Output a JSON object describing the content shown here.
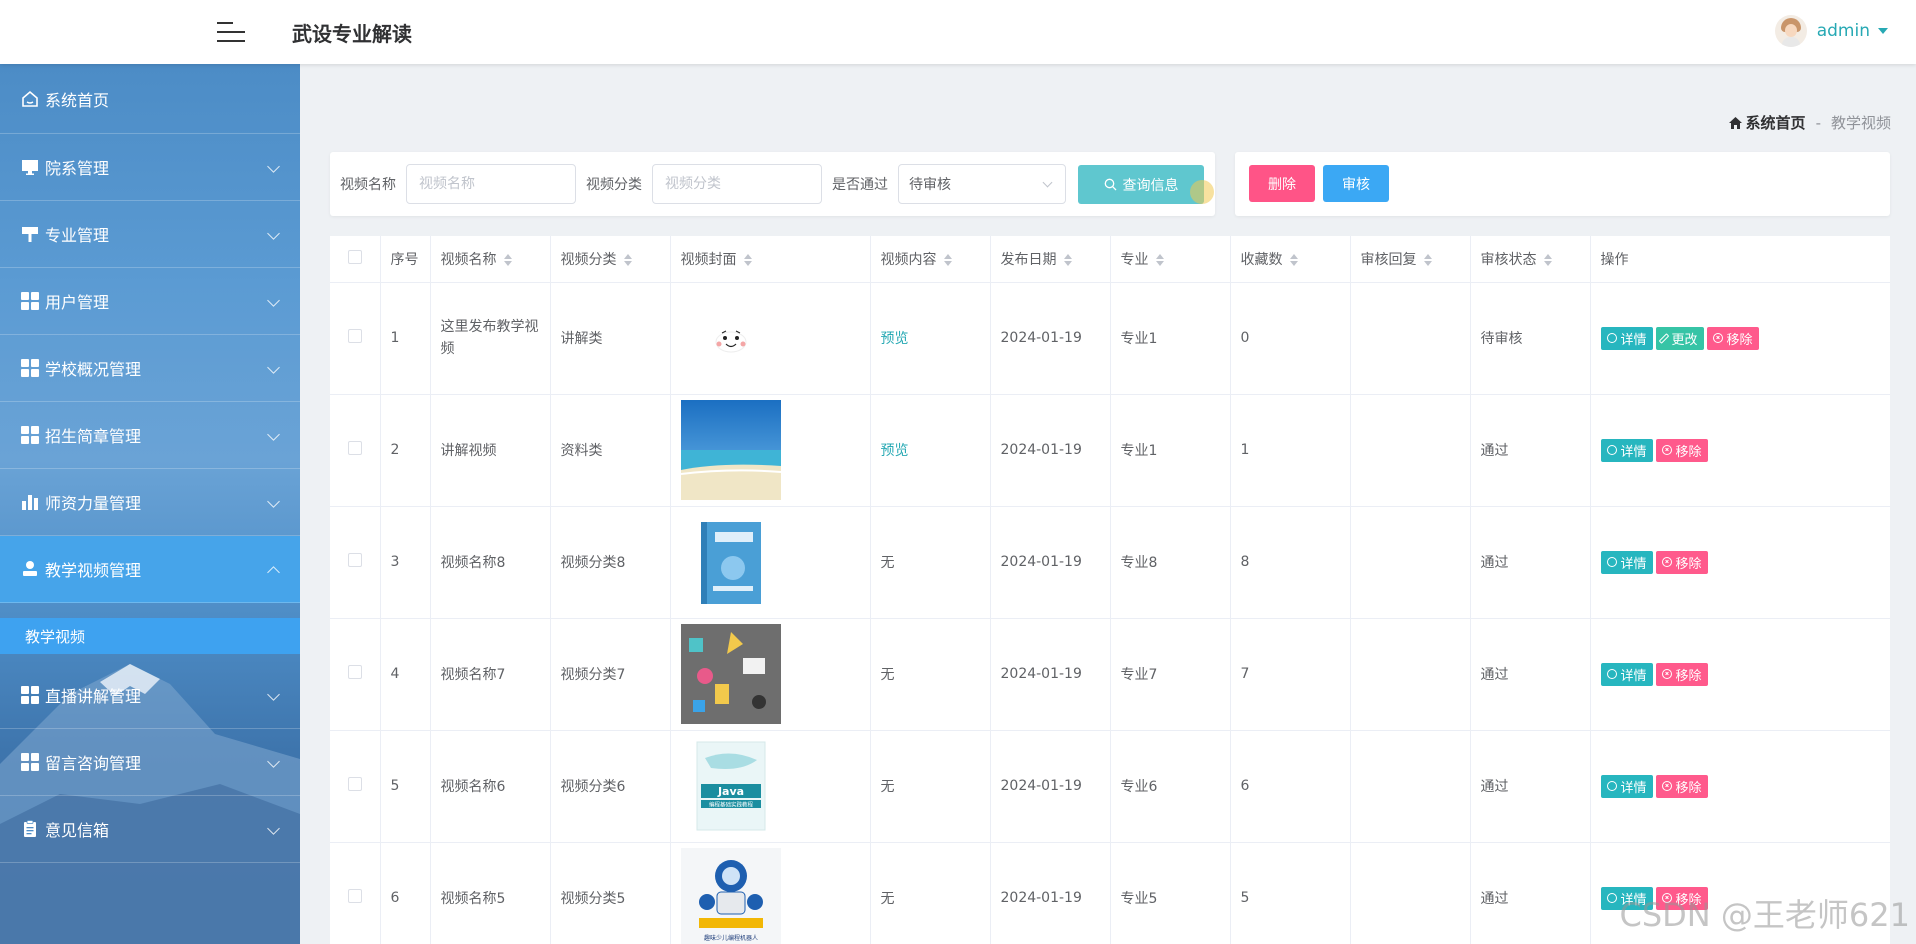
{
  "header": {
    "app_title": "武设专业解读",
    "username": "admin"
  },
  "sidebar": {
    "items": [
      {
        "label": "系统首页",
        "icon": "home-icon"
      },
      {
        "label": "院系管理",
        "icon": "monitor-icon"
      },
      {
        "label": "专业管理",
        "icon": "signpost-icon"
      },
      {
        "label": "用户管理",
        "icon": "grid-icon"
      },
      {
        "label": "学校概况管理",
        "icon": "grid-icon"
      },
      {
        "label": "招生简章管理",
        "icon": "grid-icon"
      },
      {
        "label": "师资力量管理",
        "icon": "bar-chart-icon"
      },
      {
        "label": "教学视频管理",
        "icon": "user-icon"
      },
      {
        "label": "直播讲解管理",
        "icon": "grid-icon"
      },
      {
        "label": "留言咨询管理",
        "icon": "grid-icon"
      },
      {
        "label": "意见信箱",
        "icon": "clipboard-icon"
      }
    ],
    "active_sub": "教学视频"
  },
  "breadcrumb": {
    "home": "系统首页",
    "separator": "-",
    "current": "教学视频"
  },
  "search": {
    "name_label": "视频名称",
    "name_placeholder": "视频名称",
    "category_label": "视频分类",
    "category_placeholder": "视频分类",
    "approved_label": "是否通过",
    "approved_value": "待审核",
    "query_button": "查询信息"
  },
  "actions": {
    "delete_button": "删除",
    "audit_button": "审核"
  },
  "table": {
    "columns": [
      "序号",
      "视频名称",
      "视频分类",
      "视频封面",
      "视频内容",
      "发布日期",
      "专业",
      "收藏数",
      "审核回复",
      "审核状态",
      "操作"
    ],
    "rows": [
      {
        "index": "1",
        "name": "这里发布教学视频",
        "category": "讲解类",
        "cover": "cartoon-face",
        "content": "预览",
        "date": "2024-01-19",
        "major": "专业1",
        "favorites": "0",
        "reply": "",
        "status": "待审核"
      },
      {
        "index": "2",
        "name": "讲解视频",
        "category": "资料类",
        "cover": "beach",
        "content": "预览",
        "date": "2024-01-19",
        "major": "专业1",
        "favorites": "1",
        "reply": "",
        "status": "通过"
      },
      {
        "index": "3",
        "name": "视频名称8",
        "category": "视频分类8",
        "cover": "blue-book",
        "content": "无",
        "date": "2024-01-19",
        "major": "专业8",
        "favorites": "8",
        "reply": "",
        "status": "通过"
      },
      {
        "index": "4",
        "name": "视频名称7",
        "category": "视频分类7",
        "cover": "gray-collage",
        "content": "无",
        "date": "2024-01-19",
        "major": "专业7",
        "favorites": "7",
        "reply": "",
        "status": "通过"
      },
      {
        "index": "5",
        "name": "视频名称6",
        "category": "视频分类6",
        "cover": "java-book",
        "content": "无",
        "date": "2024-01-19",
        "major": "专业6",
        "favorites": "6",
        "reply": "",
        "status": "通过"
      },
      {
        "index": "6",
        "name": "视频名称5",
        "category": "视频分类5",
        "cover": "robot-book",
        "content": "无",
        "date": "2024-01-19",
        "major": "专业5",
        "favorites": "5",
        "reply": "",
        "status": "通过"
      }
    ],
    "op_detail": "详情",
    "op_edit": "更改",
    "op_remove": "移除"
  },
  "cover_texts": {
    "java_book_word": "Java",
    "java_book_subtitle": "编程基础实践教程",
    "robot_book_subtitle": "趣味少儿编程机器人"
  },
  "watermark": "CSDN @王老师621",
  "colors": {
    "accent": "#27a9b4",
    "active_menu": "#46a4ea",
    "danger": "#ff5487",
    "primary": "#3ba8f4",
    "query": "#5fc7cf"
  }
}
